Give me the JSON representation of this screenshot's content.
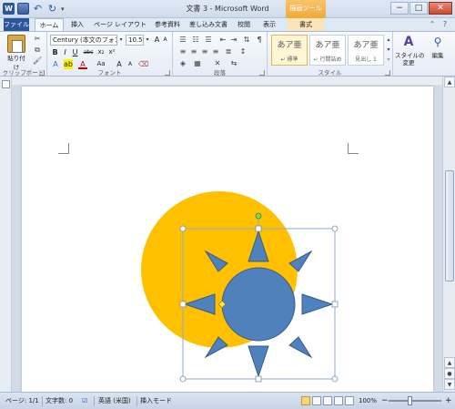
{
  "window": {
    "title": "文書 3  -  Microsoft Word",
    "context_tab_header": "描画ツール",
    "buttons": {
      "minimize": "−",
      "maximize": "□",
      "close": "✕"
    }
  },
  "qat": {
    "word_label": "W",
    "undo": "↶",
    "redo": "↻",
    "more": "▾"
  },
  "tabs": [
    {
      "label": "ファイル"
    },
    {
      "label": "ホーム"
    },
    {
      "label": "挿入"
    },
    {
      "label": "ページ レイアウト"
    },
    {
      "label": "参考資料"
    },
    {
      "label": "差し込み文書"
    },
    {
      "label": "校閲"
    },
    {
      "label": "表示"
    },
    {
      "label": "書式"
    }
  ],
  "ribbon": {
    "clipboard": {
      "paste_label": "貼り付け",
      "group_label": "クリップボード"
    },
    "font": {
      "font_name": "Century (本文のフォント",
      "font_size": "10.5",
      "bold": "B",
      "italic": "I",
      "underline": "U",
      "strike": "abc",
      "subscript": "x₂",
      "superscript": "x²",
      "grow": "A",
      "shrink": "A",
      "clear": "Aa",
      "group_label": "フォント"
    },
    "paragraph": {
      "group_label": "段落"
    },
    "styles": {
      "items": [
        {
          "sample": "あア亜",
          "name": "↵ 標準"
        },
        {
          "sample": "あア亜",
          "name": "↵ 行間詰め"
        },
        {
          "sample": "あア亜",
          "name": "見出し 1"
        }
      ],
      "change_styles": "スタイルの\n変更",
      "group_label": "スタイル"
    },
    "editing": {
      "label": "編集"
    }
  },
  "status": {
    "page": "ページ: 1/1",
    "words": "文字数: 0",
    "language": "英語 (米国)",
    "mode": "挿入モード",
    "zoom": "100%",
    "zoom_minus": "−",
    "zoom_plus": "+"
  },
  "colors": {
    "circle_fill": "#ffc000",
    "sun_fill": "#4f81bd",
    "sun_stroke": "#385d8a",
    "selection": "#8eaadb"
  }
}
